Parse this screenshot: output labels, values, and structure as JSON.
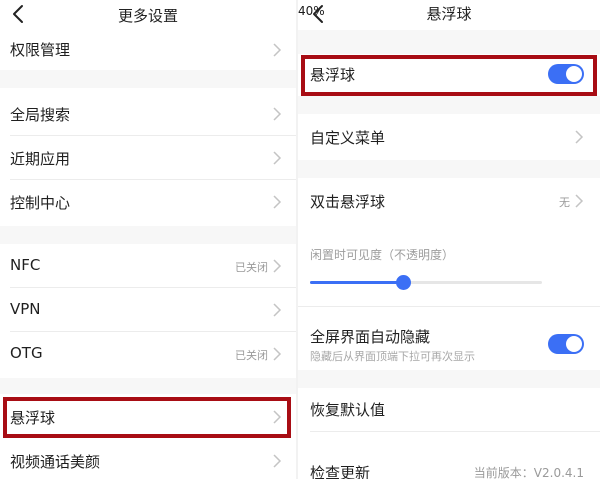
{
  "colors": {
    "accent": "#3b6ff5",
    "highlight": "#a80d14"
  },
  "left": {
    "title": "更多设置",
    "items": [
      {
        "label": "权限管理",
        "status": ""
      },
      {
        "label": "全局搜索",
        "status": ""
      },
      {
        "label": "近期应用",
        "status": ""
      },
      {
        "label": "控制中心",
        "status": ""
      },
      {
        "label": "NFC",
        "status": "已关闭"
      },
      {
        "label": "VPN",
        "status": ""
      },
      {
        "label": "OTG",
        "status": "已关闭"
      },
      {
        "label": "悬浮球",
        "status": ""
      },
      {
        "label": "视频通话美颜",
        "status": ""
      }
    ]
  },
  "right": {
    "title": "悬浮球",
    "floating_ball": {
      "label": "悬浮球",
      "enabled": true
    },
    "custom_menu": {
      "label": "自定义菜单"
    },
    "double_tap": {
      "label": "双击悬浮球",
      "value": "无"
    },
    "opacity": {
      "label": "闲置时可见度（不透明度）",
      "percent_text": "40%",
      "value": 0.4
    },
    "auto_hide": {
      "label": "全屏界面自动隐藏",
      "description": "隐藏后从界面顶端下拉可再次显示",
      "enabled": true
    },
    "restore": {
      "label": "恢复默认值"
    },
    "check_update": {
      "label": "检查更新",
      "version": "当前版本：V2.0.4.1"
    }
  }
}
